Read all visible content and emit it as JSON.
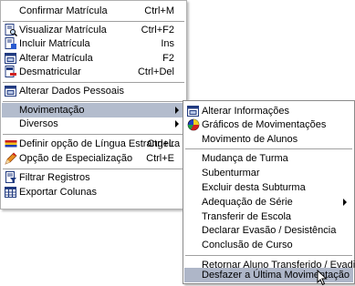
{
  "main_menu": {
    "items": [
      {
        "label": "Confirmar Matrícula",
        "shortcut": "Ctrl+M",
        "icon": "none"
      },
      {
        "label": "Visualizar Matrícula",
        "shortcut": "Ctrl+F2",
        "icon": "view-document-icon"
      },
      {
        "label": "Incluir Matrícula",
        "shortcut": "Ins",
        "icon": "add-document-icon"
      },
      {
        "label": "Alterar Matrícula",
        "shortcut": "F2",
        "icon": "edit-window-icon"
      },
      {
        "label": "Desmatricular",
        "shortcut": "Ctrl+Del",
        "icon": "remove-document-icon"
      },
      {
        "label": "Alterar Dados Pessoais",
        "shortcut": "",
        "icon": "edit-window-icon"
      },
      {
        "label": "Movimentação",
        "shortcut": "",
        "icon": "none",
        "submenu": true
      },
      {
        "label": "Diversos",
        "shortcut": "",
        "icon": "none",
        "submenu": true
      },
      {
        "label": "Definir opção de Língua Estrangeira",
        "shortcut": "Ctrl+L",
        "icon": "flag-icon"
      },
      {
        "label": "Opção de Especialização",
        "shortcut": "Ctrl+E",
        "icon": "pencil-icon"
      },
      {
        "label": "Filtrar Registros",
        "shortcut": "",
        "icon": "filter-icon"
      },
      {
        "label": "Exportar Colunas",
        "shortcut": "",
        "icon": "export-grid-icon"
      }
    ]
  },
  "sub_menu": {
    "items": [
      {
        "label": "Alterar Informações",
        "icon": "edit-window-icon"
      },
      {
        "label": "Gráficos de Movimentações",
        "icon": "pie-chart-icon"
      },
      {
        "label": "Movimento de Alunos",
        "icon": "none"
      },
      {
        "label": "Mudança de Turma",
        "icon": "none"
      },
      {
        "label": "Subenturmar",
        "icon": "none"
      },
      {
        "label": "Excluir desta Subturma",
        "icon": "none"
      },
      {
        "label": "Adequação de Série",
        "icon": "none",
        "submenu": true
      },
      {
        "label": "Transferir de Escola",
        "icon": "none"
      },
      {
        "label": "Declarar Evasão / Desistência",
        "icon": "none"
      },
      {
        "label": "Conclusão de Curso",
        "icon": "none"
      },
      {
        "label": "Retornar Aluno Transferido / Evadido",
        "icon": "none"
      },
      {
        "label": "Desfazer a Última Movimentação",
        "icon": "none"
      }
    ]
  },
  "colors": {
    "highlight": "#aeb6c8",
    "separator": "#a0a0a0"
  }
}
